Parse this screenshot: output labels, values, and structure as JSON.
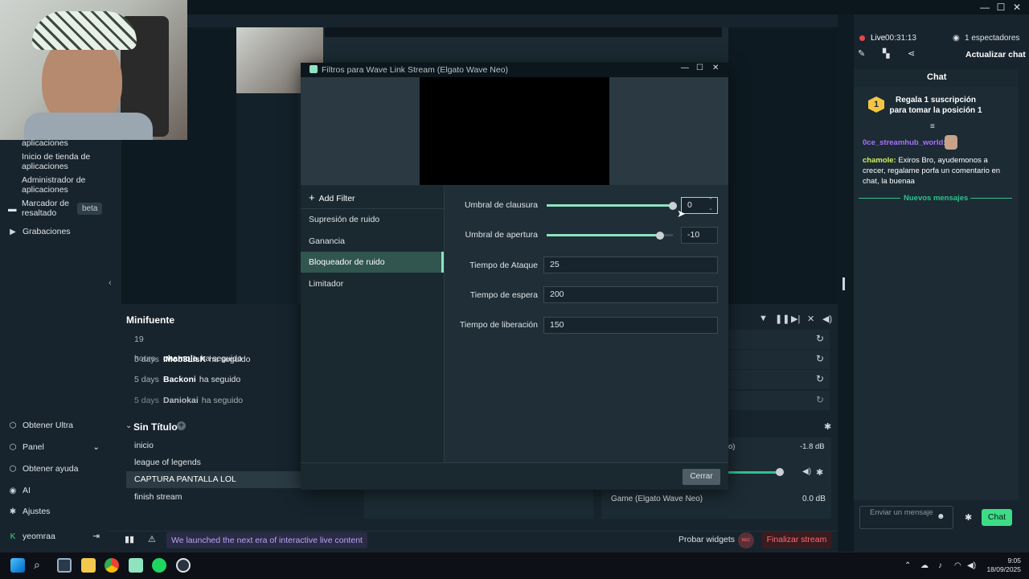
{
  "window": {
    "minimize": "—",
    "maximize": "☐",
    "close": "✕"
  },
  "sidebar": {
    "items": [
      {
        "label": "aplicaciones"
      },
      {
        "label": "Inicio de tienda de aplicaciones"
      },
      {
        "label": "Administrador de aplicaciones"
      },
      {
        "label": "Marcador de resaltado",
        "badge": "beta"
      },
      {
        "label": "Grabaciones"
      }
    ],
    "bottom": [
      {
        "label": "Obtener Ultra"
      },
      {
        "label": "Panel"
      },
      {
        "label": "Obtener ayuda"
      },
      {
        "label": "AI"
      },
      {
        "label": "Ajustes"
      },
      {
        "label": "yeomraa"
      }
    ]
  },
  "minifuente": {
    "title": "Minifuente",
    "events": [
      {
        "time": "19 hours",
        "name": "chamole",
        "action": "ha seguido"
      },
      {
        "time": "5 days",
        "name": "IMob3LisK",
        "action": "ha seguido"
      },
      {
        "time": "5 days",
        "name": "Backoni",
        "action": "ha seguido"
      },
      {
        "time": "5 days",
        "name": "Daniokai",
        "action": "ha seguido"
      }
    ]
  },
  "scenes": {
    "title": "Sin Título",
    "items": [
      "inicio",
      "league of legends",
      "CAPTURA PANTALLA LOL",
      "finish stream"
    ],
    "active_index": 2
  },
  "mixer": {
    "row1": {
      "name": "o)",
      "level": "-1.8 dB"
    },
    "row2": {
      "name": "Game (Elgato Wave Neo)",
      "level": "0.0 dB"
    }
  },
  "modal": {
    "title": "Filtros para Wave Link Stream (Elgato Wave Neo)",
    "add_filter": "Add Filter",
    "filters": [
      "Supresión de ruido",
      "Ganancia",
      "Bloqueador de ruido",
      "Limitador"
    ],
    "active_filter": "Bloqueador de ruido",
    "props": {
      "close_threshold": {
        "label": "Umbral de clausura",
        "value": "0",
        "level_pct": 100
      },
      "open_threshold": {
        "label": "Umbral de apertura",
        "value": "-10",
        "level_pct": 90
      },
      "attack": {
        "label": "Tiempo de Ataque",
        "value": "25"
      },
      "hold": {
        "label": "Tiempo de espera",
        "value": "200"
      },
      "release": {
        "label": "Tiempo de liberación",
        "value": "150"
      }
    },
    "close_button": "Cerrar"
  },
  "chat": {
    "live_label": "Live",
    "live_time": "00:31:13",
    "viewers": "1 espectadores",
    "refresh": "Actualizar chat",
    "title": "Chat",
    "gift_rank": "1",
    "gift_text": "Regala 1 suscripción para tomar la posición 1",
    "messages": [
      {
        "user": "0ce_streamhub_world",
        "text": "",
        "user_color": "#a970ff"
      },
      {
        "user": "chamole",
        "text": "Exiros Bro, ayudemonos a crecer, regalame porfa un comentario en chat, la buenaa",
        "user_color": "#d4f25c"
      }
    ],
    "new_messages": "Nuevos mensajes",
    "input_placeholder": "Enviar un mensaje",
    "send": "Chat"
  },
  "statusbar": {
    "announcement": "We launched the next era of interactive live content",
    "test_widgets": "Probar widgets",
    "rec": "REC",
    "end_stream": "Finalizar stream"
  },
  "taskbar": {
    "time": "9:05",
    "date": "18/09/2025"
  },
  "colors": {
    "accent": "#8fe3bf",
    "chat_button": "#3ddc84",
    "end_stream": "#ff6b75"
  }
}
